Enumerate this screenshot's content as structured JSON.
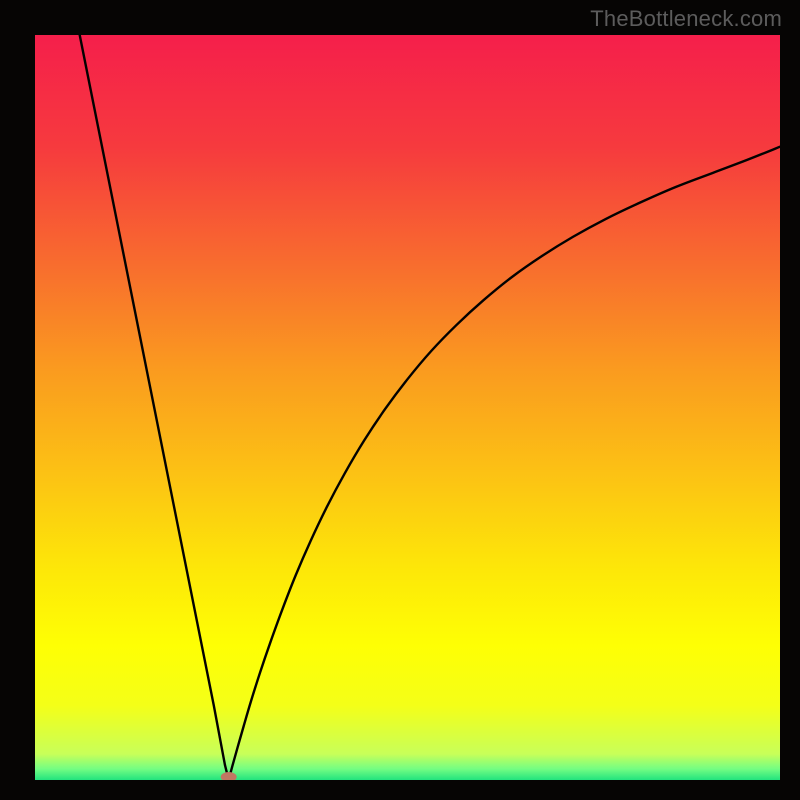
{
  "watermark": "TheBottleneck.com",
  "chart_data": {
    "type": "line",
    "title": "",
    "xlabel": "",
    "ylabel": "",
    "xlim": [
      0,
      100
    ],
    "ylim": [
      0,
      100
    ],
    "gradient_stops": [
      {
        "offset": 0.0,
        "color": "#f51f4b"
      },
      {
        "offset": 0.15,
        "color": "#f63a3e"
      },
      {
        "offset": 0.3,
        "color": "#f86a2f"
      },
      {
        "offset": 0.45,
        "color": "#fa9b1f"
      },
      {
        "offset": 0.6,
        "color": "#fcc513"
      },
      {
        "offset": 0.72,
        "color": "#fde808"
      },
      {
        "offset": 0.82,
        "color": "#feff04"
      },
      {
        "offset": 0.9,
        "color": "#f4ff18"
      },
      {
        "offset": 0.965,
        "color": "#c8ff59"
      },
      {
        "offset": 0.985,
        "color": "#74fd83"
      },
      {
        "offset": 1.0,
        "color": "#22e37e"
      }
    ],
    "curve": {
      "minimum_x": 26,
      "left_top_x": 6,
      "left_top_y": 100,
      "right_end_x": 100,
      "right_end_y": 85,
      "left_points": [
        {
          "x": 6,
          "y": 100
        },
        {
          "x": 8,
          "y": 90
        },
        {
          "x": 10,
          "y": 80
        },
        {
          "x": 12,
          "y": 70
        },
        {
          "x": 14,
          "y": 60
        },
        {
          "x": 16,
          "y": 50
        },
        {
          "x": 18,
          "y": 40
        },
        {
          "x": 20,
          "y": 30
        },
        {
          "x": 22,
          "y": 20
        },
        {
          "x": 24,
          "y": 10
        },
        {
          "x": 25.5,
          "y": 2
        },
        {
          "x": 26,
          "y": 0
        }
      ],
      "right_points": [
        {
          "x": 26,
          "y": 0
        },
        {
          "x": 26.5,
          "y": 1.9
        },
        {
          "x": 27.2,
          "y": 4.4
        },
        {
          "x": 28.0,
          "y": 7.2
        },
        {
          "x": 29.0,
          "y": 10.6
        },
        {
          "x": 30.2,
          "y": 14.4
        },
        {
          "x": 31.6,
          "y": 18.5
        },
        {
          "x": 33.2,
          "y": 22.9
        },
        {
          "x": 35.0,
          "y": 27.5
        },
        {
          "x": 37.0,
          "y": 32.1
        },
        {
          "x": 39.2,
          "y": 36.7
        },
        {
          "x": 41.6,
          "y": 41.2
        },
        {
          "x": 44.2,
          "y": 45.6
        },
        {
          "x": 47.0,
          "y": 49.8
        },
        {
          "x": 50.0,
          "y": 53.8
        },
        {
          "x": 53.2,
          "y": 57.6
        },
        {
          "x": 56.6,
          "y": 61.1
        },
        {
          "x": 60.2,
          "y": 64.4
        },
        {
          "x": 64.0,
          "y": 67.5
        },
        {
          "x": 68.0,
          "y": 70.3
        },
        {
          "x": 72.2,
          "y": 72.9
        },
        {
          "x": 76.6,
          "y": 75.3
        },
        {
          "x": 81.2,
          "y": 77.5
        },
        {
          "x": 86.0,
          "y": 79.6
        },
        {
          "x": 91.0,
          "y": 81.5
        },
        {
          "x": 95.5,
          "y": 83.2
        },
        {
          "x": 100.0,
          "y": 85.0
        }
      ]
    },
    "marker": {
      "x": 26,
      "y": 0,
      "color": "#c07862",
      "rx": 8,
      "ry": 5
    }
  }
}
